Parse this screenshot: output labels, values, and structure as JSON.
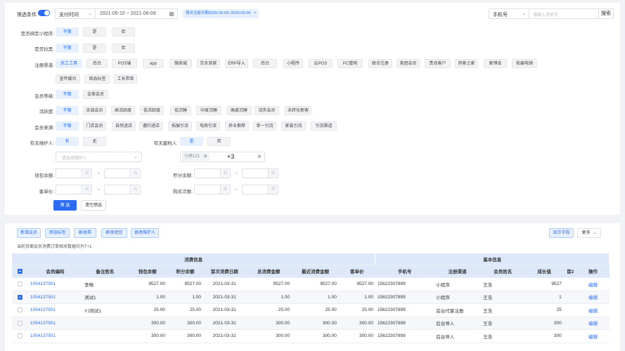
{
  "filter": {
    "toggle_label": "筛选条件",
    "time_type": "支付时间",
    "date_range": "2021-05-10  ~  2021-06-09",
    "date_tag": "首次注册日期2020-06-09~2020-06-09",
    "phone_select": "手机号",
    "phone_placeholder": "请输入手机号",
    "search_btn": "搜索"
  },
  "rows": {
    "bind_mini": {
      "label": "是否绑定小程序:",
      "opts": [
        "不限",
        "是",
        "否"
      ]
    },
    "blacklist": {
      "label": "是否拉黑:",
      "opts": [
        "不限",
        "是",
        "否"
      ]
    },
    "channel": {
      "label": "注册渠道:",
      "opts": [
        "员工工具",
        "后台",
        "POS端",
        "app",
        "微商城",
        "京东到家",
        "ERP导入",
        "后台",
        "小程序",
        "云POS",
        "PC管网",
        "联合注册",
        "美团会员",
        "贵尚客户",
        "房客之家",
        "家博会",
        "拓展电销",
        "宣传缓台",
        "商品标签",
        "工长带单"
      ]
    },
    "level": {
      "label": "会员等级:",
      "opts": [
        "不限",
        "金美会员"
      ]
    },
    "activity": {
      "label": "活跃度:",
      "opts": [
        "不限",
        "忠诚会员",
        "高活跃度",
        "低活跃度",
        "低沉睡",
        "中度沉睡",
        "高度沉睡",
        "流失会员",
        "未转化新客"
      ]
    },
    "source": {
      "label": "会员来源:",
      "opts": [
        "不限",
        "门店会员",
        "自然进店",
        "邀约进店",
        "拓展引流",
        "电商引流",
        "异业推荐",
        "单一引流",
        "家装引流",
        "引流渠道"
      ]
    },
    "maintainer": {
      "label": "有无维护人:",
      "opts": [
        "有",
        "无"
      ]
    },
    "builder": {
      "label": "有无建档人:",
      "opts": [
        "是",
        "否"
      ]
    },
    "maintainer_placeholder": "请选择维护人",
    "builder_tag": "小虎121",
    "builder_more": "+3",
    "wallet_label": "钱包余额:",
    "wallet_unit": "元",
    "points_label": "积分余额:",
    "points_unit": "分",
    "avg_label": "客单价:",
    "avg_unit": "元",
    "buy_label": "购买次数:",
    "buy_unit": "次",
    "dash": "-",
    "submit": "筛 选",
    "clear": "清空筛选"
  },
  "toolbar": {
    "buttons": [
      "新增会员",
      "添加标签",
      "群发券",
      "群发短信",
      "更改维护人"
    ],
    "show_fields": "显示字段",
    "more": "更多",
    "note": "当前页面会员消费订单相关数据均为T+1"
  },
  "table": {
    "group_consume": "消费信息",
    "group_basic": "基本信息",
    "headers": [
      "会员编码",
      "备注姓名",
      "钱包余额",
      "积分余额",
      "首次消费日期",
      "总消费金额",
      "最近消费金额",
      "客单价",
      "手机号",
      "注册渠道",
      "会员姓名",
      "成长值",
      "首2",
      "操作"
    ],
    "rows": [
      [
        "1054137501",
        "李畅",
        "9527.00",
        "9527.00",
        "2021-03-31",
        "9527.00",
        "9527.00",
        "9527.00",
        "15622307899",
        "小程序",
        "王浩",
        "9527",
        "",
        "编辑"
      ],
      [
        "1054137501",
        "测试1",
        "1.00",
        "1.00",
        "2021-03-31",
        "1.00",
        "1.00",
        "1.00",
        "15622307899",
        "小程序",
        "王浩",
        "1",
        "",
        "编辑"
      ],
      [
        "1054137501",
        "YJ测试1",
        "25.00",
        "25.00",
        "2021-03-31",
        "25.00",
        "25.00",
        "25.00",
        "15622307899",
        "后台代客注册",
        "王浩",
        "25",
        "",
        "编辑"
      ],
      [
        "1054137501",
        "",
        "300.00",
        "300.00",
        "2021-03-31",
        "300.00",
        "300.00",
        "300.00",
        "15622307899",
        "后台导入",
        "王浩",
        "300",
        "",
        "编辑"
      ],
      [
        "1054137501",
        "",
        "300.00",
        "300.00",
        "2021-03-31",
        "300.00",
        "300.00",
        "300.00",
        "15622307899",
        "后台导入",
        "王浩",
        "300",
        "",
        "编辑"
      ]
    ],
    "checked": [
      false,
      true,
      false,
      false,
      false
    ]
  },
  "colors": {
    "accent": "#2b6cf2",
    "selected_bg": "#e6f0ff",
    "header_bg": "#dde9fb"
  }
}
